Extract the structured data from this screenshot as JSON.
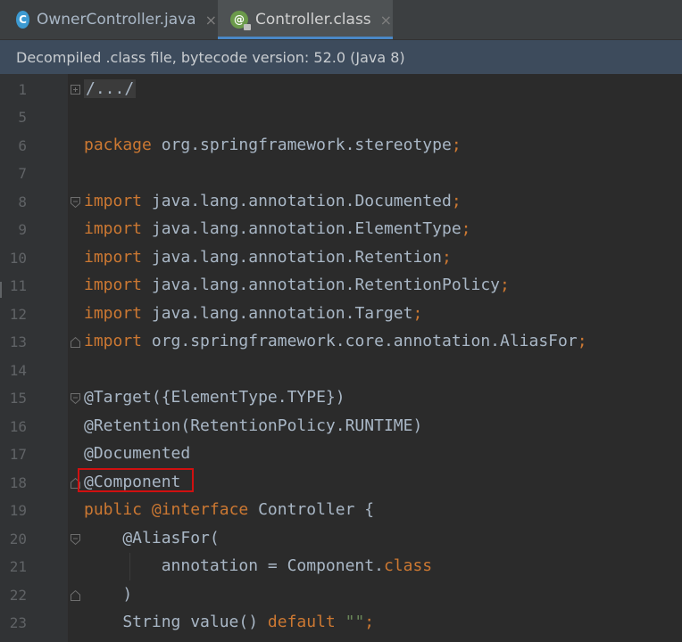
{
  "tabs": [
    {
      "label": "OwnerController.java",
      "icon": "class-c-icon",
      "letter": "C",
      "close": "×",
      "active": false
    },
    {
      "label": "Controller.class",
      "icon": "annotation-at-icon",
      "letter": "@",
      "close": "×",
      "active": true
    }
  ],
  "banner": {
    "text": "Decompiled .class file, bytecode version: 52.0 (Java 8)"
  },
  "lines": [
    {
      "num": "1",
      "text": "/.../"
    },
    {
      "num": "5",
      "text": ""
    },
    {
      "num": "6",
      "kw": "package",
      "rest": " org.springframework.stereotype",
      "semi": ";"
    },
    {
      "num": "7",
      "text": ""
    },
    {
      "num": "8",
      "kw": "import",
      "rest": " java.lang.annotation.Documented",
      "semi": ";"
    },
    {
      "num": "9",
      "kw": "import",
      "rest": " java.lang.annotation.ElementType",
      "semi": ";"
    },
    {
      "num": "10",
      "kw": "import",
      "rest": " java.lang.annotation.Retention",
      "semi": ";"
    },
    {
      "num": "11",
      "kw": "import",
      "rest": " java.lang.annotation.RetentionPolicy",
      "semi": ";"
    },
    {
      "num": "12",
      "kw": "import",
      "rest": " java.lang.annotation.Target",
      "semi": ";"
    },
    {
      "num": "13",
      "kw": "import",
      "rest": " org.springframework.core.annotation.AliasFor",
      "semi": ";"
    },
    {
      "num": "14",
      "text": ""
    },
    {
      "num": "15",
      "text": "@Target({ElementType.TYPE})"
    },
    {
      "num": "16",
      "text": "@Retention(RetentionPolicy.RUNTIME)"
    },
    {
      "num": "17",
      "text": "@Documented"
    },
    {
      "num": "18",
      "text": "@Component"
    },
    {
      "num": "19",
      "kw": "public",
      "kw2": " @interface",
      "rest": " Controller {"
    },
    {
      "num": "20",
      "text": "    @AliasFor("
    },
    {
      "num": "21",
      "pre": "        annotation = Component.",
      "kw": "class"
    },
    {
      "num": "22",
      "text": "    )"
    },
    {
      "num": "23",
      "pre": "    String value() ",
      "kw": "default",
      "str": " \"\"",
      "semi": ";"
    }
  ],
  "colors": {
    "keyword": "#cc7832",
    "annotation": "#bbb529",
    "string": "#6a8759",
    "text": "#a9b7c6",
    "highlight_box": "#d01010"
  }
}
